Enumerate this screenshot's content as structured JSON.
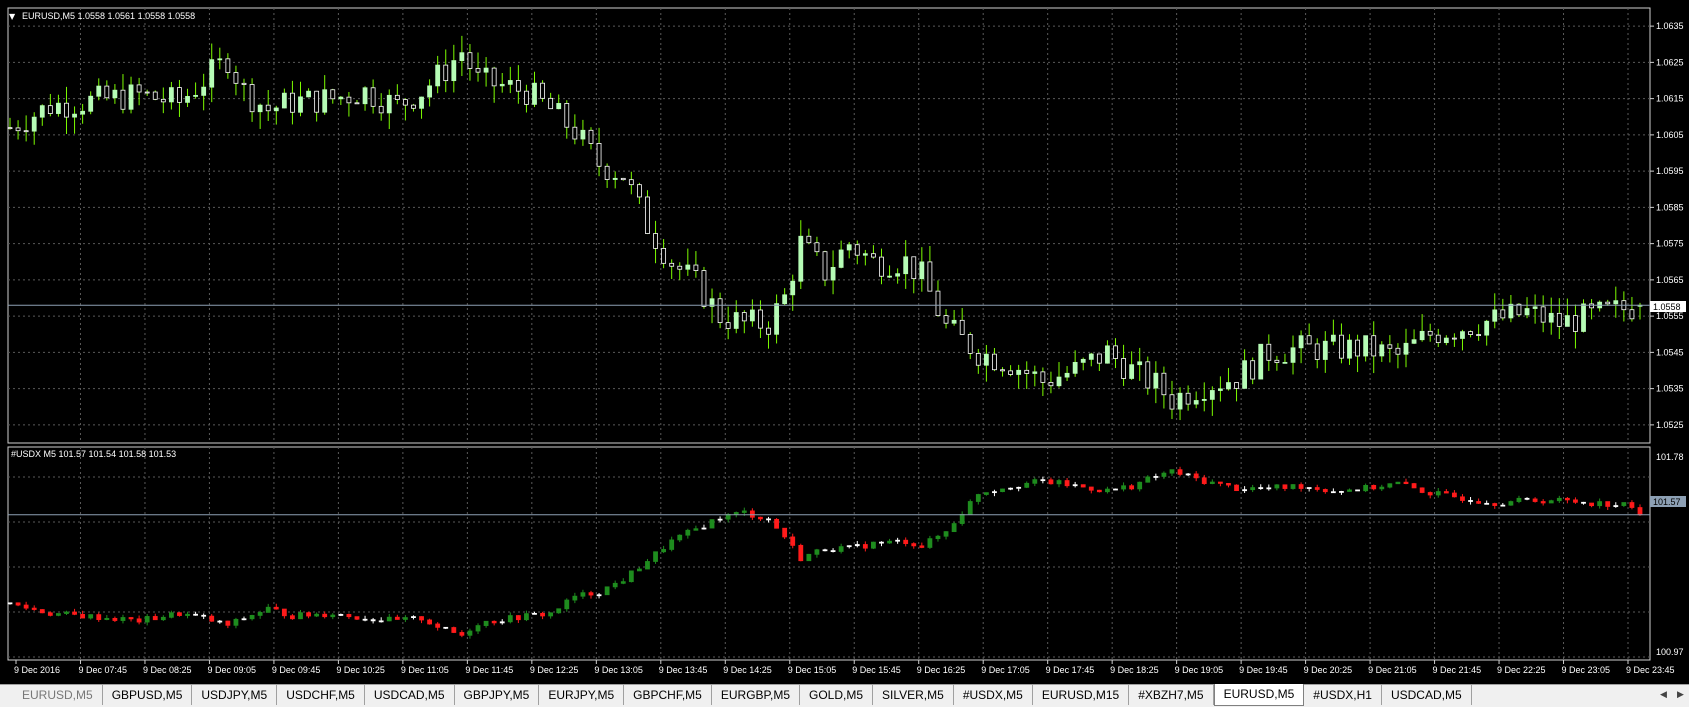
{
  "colors": {
    "background": "#000000",
    "grid": "#5a5a5a",
    "frame": "#cfcfcf",
    "text": "#ffffff",
    "bull_eurusd": "#b6fcb6",
    "bear_eurusd": "#ffffff",
    "wick_eurusd": "#7cfc00",
    "bull_usdx": "#1e8c1e",
    "bear_usdx": "#ff1b1b",
    "doji_usdx": "#ffffff",
    "price_line": "#8da0b4"
  },
  "main_panel": {
    "header": "EURUSD,M5  1.0558 1.0561 1.0558 1.0558",
    "y_ticks": [
      "1.0635",
      "1.0625",
      "1.0615",
      "1.0605",
      "1.0595",
      "1.0585",
      "1.0575",
      "1.0565",
      "1.0555",
      "1.0545",
      "1.0535",
      "1.0525"
    ],
    "current_price": "1.0558"
  },
  "sub_panel": {
    "header": "#USDX M5 101.57 101.54 101.58 101.53",
    "y_ticks": [
      "101.78",
      "100.97"
    ],
    "current_price": "101.57"
  },
  "x_ticks": [
    "9 Dec 2016",
    "9 Dec 07:45",
    "9 Dec 08:25",
    "9 Dec 09:05",
    "9 Dec 09:45",
    "9 Dec 10:25",
    "9 Dec 11:05",
    "9 Dec 11:45",
    "9 Dec 12:25",
    "9 Dec 13:05",
    "9 Dec 13:45",
    "9 Dec 14:25",
    "9 Dec 15:05",
    "9 Dec 15:45",
    "9 Dec 16:25",
    "9 Dec 17:05",
    "9 Dec 17:45",
    "9 Dec 18:25",
    "9 Dec 19:05",
    "9 Dec 19:45",
    "9 Dec 20:25",
    "9 Dec 21:05",
    "9 Dec 21:45",
    "9 Dec 22:25",
    "9 Dec 23:05",
    "9 Dec 23:45"
  ],
  "tabs": [
    "EURUSD,M5",
    "GBPUSD,M5",
    "USDJPY,M5",
    "USDCHF,M5",
    "USDCAD,M5",
    "GBPJPY,M5",
    "EURJPY,M5",
    "GBPCHF,M5",
    "EURGBP,M5",
    "GOLD,M5",
    "SILVER,M5",
    "#USDX,M5",
    "EURUSD,M15",
    "#XBZH7,M5",
    "EURUSD,M5",
    "#USDX,H1",
    "USDCAD,M5"
  ],
  "active_tab": 14,
  "chart_data": [
    {
      "type": "candlestick",
      "title": "EURUSD,M5  1.0558 1.0561 1.0558 1.0558",
      "symbol": "EURUSD",
      "timeframe": "M5",
      "ylim": [
        1.052,
        1.064
      ],
      "x_start": "9 Dec 2016 07:05",
      "x_end": "9 Dec 23:55",
      "series": [
        {
          "name": "EURUSD",
          "close_path": [
            [
              "07:05",
              1.0607
            ],
            [
              "07:30",
              1.0613
            ],
            [
              "07:50",
              1.0614
            ],
            [
              "08:25",
              1.0616
            ],
            [
              "08:50",
              1.0614
            ],
            [
              "09:05",
              1.062
            ],
            [
              "09:20",
              1.0626
            ],
            [
              "09:30",
              1.0617
            ],
            [
              "09:45",
              1.0612
            ],
            [
              "10:00",
              1.0614
            ],
            [
              "10:25",
              1.0615
            ],
            [
              "10:45",
              1.0617
            ],
            [
              "11:05",
              1.0613
            ],
            [
              "11:20",
              1.0617
            ],
            [
              "11:35",
              1.0623
            ],
            [
              "11:45",
              1.0628
            ],
            [
              "11:55",
              1.062
            ],
            [
              "12:25",
              1.0617
            ],
            [
              "12:40",
              1.0612
            ],
            [
              "12:55",
              1.0606
            ],
            [
              "13:10",
              1.0597
            ],
            [
              "13:25",
              1.0594
            ],
            [
              "13:40",
              1.058
            ],
            [
              "13:55",
              1.057
            ],
            [
              "14:10",
              1.0564
            ],
            [
              "14:25",
              1.0555
            ],
            [
              "14:40",
              1.0553
            ],
            [
              "14:55",
              1.0553
            ],
            [
              "15:05",
              1.056
            ],
            [
              "15:15",
              1.0575
            ],
            [
              "15:30",
              1.0567
            ],
            [
              "15:45",
              1.0575
            ],
            [
              "16:00",
              1.057
            ],
            [
              "16:20",
              1.057
            ],
            [
              "16:30",
              1.0566
            ],
            [
              "16:45",
              1.0552
            ],
            [
              "17:05",
              1.0545
            ],
            [
              "17:25",
              1.0542
            ],
            [
              "17:45",
              1.0537
            ],
            [
              "18:05",
              1.054
            ],
            [
              "18:25",
              1.0545
            ],
            [
              "18:40",
              1.054
            ],
            [
              "18:55",
              1.0536
            ],
            [
              "19:05",
              1.0532
            ],
            [
              "19:25",
              1.0536
            ],
            [
              "19:45",
              1.0538
            ],
            [
              "20:05",
              1.0545
            ],
            [
              "20:25",
              1.0546
            ],
            [
              "20:45",
              1.0546
            ],
            [
              "21:05",
              1.0546
            ],
            [
              "21:25",
              1.0544
            ],
            [
              "21:45",
              1.055
            ],
            [
              "22:05",
              1.0552
            ],
            [
              "22:25",
              1.0554
            ],
            [
              "22:45",
              1.0556
            ],
            [
              "23:05",
              1.0553
            ],
            [
              "23:25",
              1.0555
            ],
            [
              "23:45",
              1.0557
            ],
            [
              "23:55",
              1.0558
            ]
          ]
        }
      ],
      "last": {
        "open": 1.0558,
        "high": 1.0561,
        "low": 1.0558,
        "close": 1.0558
      }
    },
    {
      "type": "candlestick",
      "title": "#USDX M5 101.57 101.54 101.58 101.53",
      "symbol": "#USDX",
      "timeframe": "M5",
      "ylim": [
        100.97,
        101.78
      ],
      "series": [
        {
          "name": "#USDX",
          "close_path": [
            [
              "07:05",
              101.17
            ],
            [
              "07:30",
              101.13
            ],
            [
              "07:50",
              101.12
            ],
            [
              "08:25",
              101.1
            ],
            [
              "08:50",
              101.13
            ],
            [
              "09:05",
              101.11
            ],
            [
              "09:20",
              101.08
            ],
            [
              "09:30",
              101.11
            ],
            [
              "09:45",
              101.15
            ],
            [
              "10:00",
              101.12
            ],
            [
              "10:25",
              101.13
            ],
            [
              "10:45",
              101.11
            ],
            [
              "11:05",
              101.1
            ],
            [
              "11:20",
              101.11
            ],
            [
              "11:35",
              101.06
            ],
            [
              "11:45",
              101.04
            ],
            [
              "11:55",
              101.09
            ],
            [
              "12:25",
              101.12
            ],
            [
              "12:40",
              101.13
            ],
            [
              "12:55",
              101.2
            ],
            [
              "13:10",
              101.22
            ],
            [
              "13:25",
              101.27
            ],
            [
              "13:40",
              101.35
            ],
            [
              "13:55",
              101.43
            ],
            [
              "14:10",
              101.48
            ],
            [
              "14:25",
              101.53
            ],
            [
              "14:40",
              101.55
            ],
            [
              "14:55",
              101.52
            ],
            [
              "15:05",
              101.45
            ],
            [
              "15:15",
              101.36
            ],
            [
              "15:30",
              101.4
            ],
            [
              "15:45",
              101.4
            ],
            [
              "16:00",
              101.42
            ],
            [
              "16:20",
              101.43
            ],
            [
              "16:30",
              101.41
            ],
            [
              "16:45",
              101.47
            ],
            [
              "17:05",
              101.63
            ],
            [
              "17:25",
              101.66
            ],
            [
              "17:45",
              101.68
            ],
            [
              "18:05",
              101.66
            ],
            [
              "18:25",
              101.64
            ],
            [
              "18:40",
              101.66
            ],
            [
              "18:55",
              101.7
            ],
            [
              "19:05",
              101.72
            ],
            [
              "19:25",
              101.68
            ],
            [
              "19:45",
              101.65
            ],
            [
              "20:05",
              101.65
            ],
            [
              "20:25",
              101.66
            ],
            [
              "20:45",
              101.64
            ],
            [
              "21:05",
              101.65
            ],
            [
              "21:25",
              101.67
            ],
            [
              "21:45",
              101.63
            ],
            [
              "22:05",
              101.61
            ],
            [
              "22:25",
              101.59
            ],
            [
              "22:45",
              101.6
            ],
            [
              "23:05",
              101.6
            ],
            [
              "23:25",
              101.59
            ],
            [
              "23:45",
              101.58
            ],
            [
              "23:55",
              101.57
            ]
          ]
        }
      ],
      "last": {
        "open": 101.57,
        "high": 101.58,
        "low": 101.53,
        "close": 101.54
      }
    }
  ]
}
